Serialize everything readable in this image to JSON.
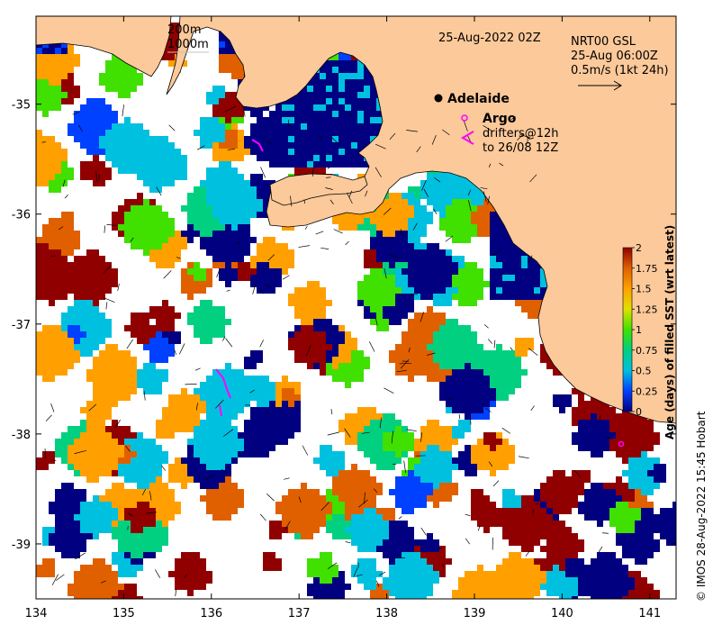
{
  "map": {
    "date_label": "25-Aug-2022 02Z",
    "depth_contours": [
      "200m",
      "1000m"
    ],
    "current_source": "NRT00 GSL",
    "current_time": "25-Aug 06:00Z",
    "vector_scale": "0.5m/s (1kt 24h)",
    "city": "Adelaide",
    "legend_argo": "Argo",
    "legend_drifters_1": "drifters@12h",
    "legend_drifters_2": "to 26/08 12Z",
    "credit": "© IMOS 28-Aug-2022 15:45 Hobart",
    "x_axis": {
      "range": [
        134,
        141.3
      ],
      "ticks": [
        "134",
        "135",
        "136",
        "137",
        "138",
        "139",
        "140",
        "141"
      ]
    },
    "y_axis": {
      "range": [
        -39.5,
        -34.2
      ],
      "ticks": [
        "-35",
        "-36",
        "-37",
        "-38",
        "-39"
      ]
    },
    "colors": {
      "land": "#fcc99a",
      "coast": "#000000",
      "argo": "#ff00ff",
      "drifter": "#ff00ff"
    }
  },
  "colorbar": {
    "label": "Age (days) of filled SST (wrt latest)",
    "ticks": [
      "0",
      "0.25",
      "0.5",
      "0.75",
      "1",
      "1.25",
      "1.5",
      "1.75",
      "2"
    ],
    "range": [
      0,
      2
    ],
    "colors": [
      "#000080",
      "#0040ff",
      "#00c0e0",
      "#00d080",
      "#40e000",
      "#e0e000",
      "#ffa000",
      "#e06000",
      "#900000"
    ]
  }
}
